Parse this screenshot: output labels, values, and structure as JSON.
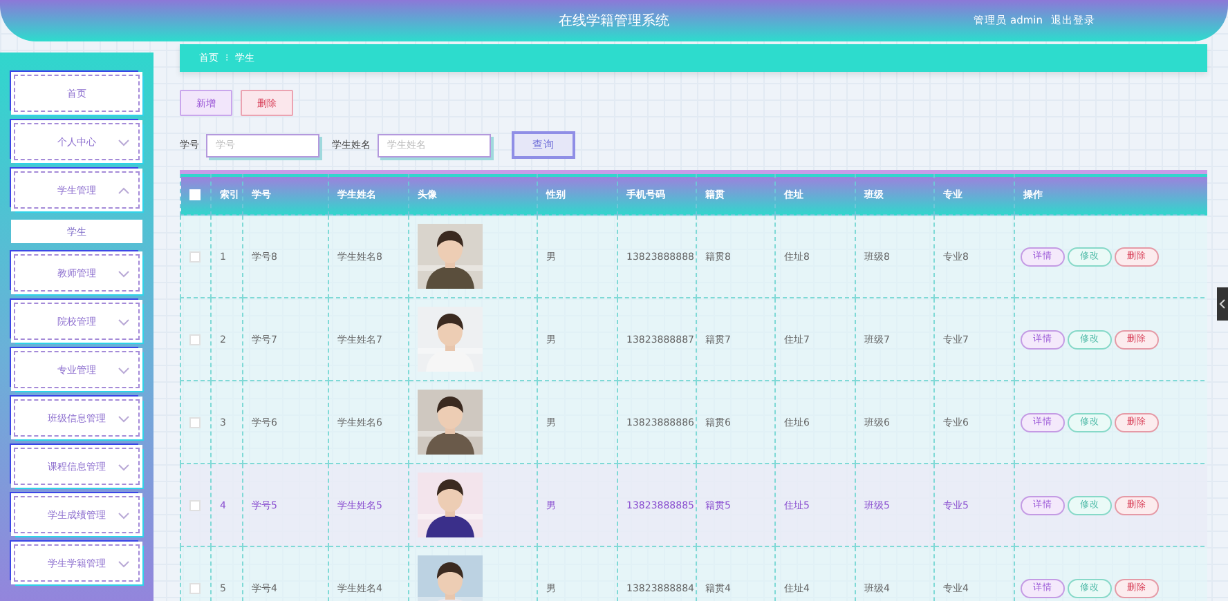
{
  "header": {
    "title": "在线学籍管理系统",
    "user": "管理员 admin",
    "logout": "退出登录"
  },
  "sidebar": {
    "items": [
      {
        "label": "首页"
      },
      {
        "label": "个人中心",
        "expanded": false
      },
      {
        "label": "学生管理",
        "expanded": true,
        "children": [
          {
            "label": "学生"
          }
        ]
      },
      {
        "label": "教师管理",
        "expanded": false
      },
      {
        "label": "院校管理",
        "expanded": false
      },
      {
        "label": "专业管理",
        "expanded": false
      },
      {
        "label": "班级信息管理",
        "expanded": false
      },
      {
        "label": "课程信息管理",
        "expanded": false
      },
      {
        "label": "学生成绩管理",
        "expanded": false
      },
      {
        "label": "学生学籍管理",
        "expanded": false
      }
    ]
  },
  "breadcrumb": [
    "首页",
    "学生"
  ],
  "breadcrumb_separator": "⁝",
  "actions": [
    {
      "label": "新增",
      "kind": "add"
    },
    {
      "label": "删除",
      "kind": "delete"
    }
  ],
  "search": {
    "fields": [
      {
        "label": "学号",
        "placeholder": "学号"
      },
      {
        "label": "学生姓名",
        "placeholder": "学生姓名"
      }
    ],
    "button": "查询"
  },
  "table": {
    "select_all_checked": false,
    "columns": [
      "索引",
      "学号",
      "学生姓名",
      "头像",
      "性别",
      "手机号码",
      "籍贯",
      "住址",
      "班级",
      "专业",
      "操作"
    ],
    "rows": [
      {
        "index": "1",
        "id": "学号8",
        "name": "学生姓名8",
        "gender": "男",
        "phone": "13823888888",
        "origin": "籍贯8",
        "address": "住址8",
        "class": "班级8",
        "major": "专业8",
        "checked": false,
        "hovered": false,
        "actions": [
          {
            "label": "详情",
            "kind": "detail"
          },
          {
            "label": "修改",
            "kind": "edit"
          },
          {
            "label": "删除",
            "kind": "delete"
          }
        ]
      },
      {
        "index": "2",
        "id": "学号7",
        "name": "学生姓名7",
        "gender": "男",
        "phone": "13823888887",
        "origin": "籍贯7",
        "address": "住址7",
        "class": "班级7",
        "major": "专业7",
        "checked": false,
        "hovered": false,
        "actions": [
          {
            "label": "详情",
            "kind": "detail"
          },
          {
            "label": "修改",
            "kind": "edit"
          },
          {
            "label": "删除",
            "kind": "delete"
          }
        ]
      },
      {
        "index": "3",
        "id": "学号6",
        "name": "学生姓名6",
        "gender": "男",
        "phone": "13823888886",
        "origin": "籍贯6",
        "address": "住址6",
        "class": "班级6",
        "major": "专业6",
        "checked": false,
        "hovered": false,
        "actions": [
          {
            "label": "详情",
            "kind": "detail"
          },
          {
            "label": "修改",
            "kind": "edit"
          },
          {
            "label": "删除",
            "kind": "delete"
          }
        ]
      },
      {
        "index": "4",
        "id": "学号5",
        "name": "学生姓名5",
        "gender": "男",
        "phone": "13823888885",
        "origin": "籍贯5",
        "address": "住址5",
        "class": "班级5",
        "major": "专业5",
        "checked": false,
        "hovered": true,
        "actions": [
          {
            "label": "详情",
            "kind": "detail"
          },
          {
            "label": "修改",
            "kind": "edit"
          },
          {
            "label": "删除",
            "kind": "delete"
          }
        ]
      },
      {
        "index": "5",
        "id": "学号4",
        "name": "学生姓名4",
        "gender": "男",
        "phone": "13823888884",
        "origin": "籍贯4",
        "address": "住址4",
        "class": "班级4",
        "major": "专业4",
        "checked": false,
        "hovered": false,
        "actions": [
          {
            "label": "详情",
            "kind": "detail"
          },
          {
            "label": "修改",
            "kind": "edit"
          },
          {
            "label": "删除",
            "kind": "delete"
          }
        ]
      }
    ]
  }
}
